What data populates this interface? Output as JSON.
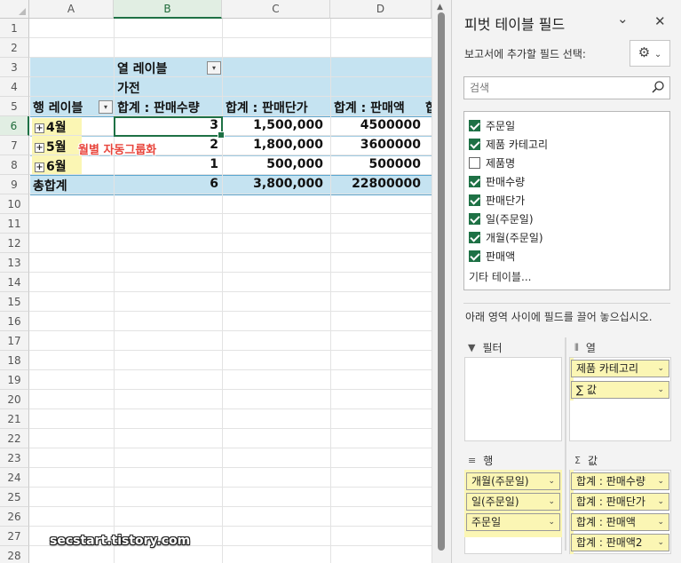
{
  "sheet": {
    "columns": [
      "A",
      "B",
      "C",
      "D"
    ],
    "rows": [
      "1",
      "2",
      "3",
      "4",
      "5",
      "6",
      "7",
      "8",
      "9",
      "10",
      "11",
      "12",
      "13",
      "14",
      "15",
      "16",
      "17",
      "18",
      "19",
      "20",
      "21",
      "22",
      "23",
      "24",
      "25",
      "26",
      "27",
      "28"
    ],
    "pivot": {
      "col_label_header": "열 레이블",
      "col_category": "가전",
      "row_label_header": "행 레이블",
      "value_headers": [
        "합계 : 판매수량",
        "합계 : 판매단가",
        "합계 : 판매액",
        "합"
      ],
      "rows": [
        {
          "label": "4월",
          "values": [
            "3",
            "1,500,000",
            "4500000"
          ]
        },
        {
          "label": "5월",
          "values": [
            "2",
            "1,800,000",
            "3600000"
          ]
        },
        {
          "label": "6월",
          "values": [
            "1",
            "500,000",
            "500000"
          ]
        }
      ],
      "total": {
        "label": "총합계",
        "values": [
          "6",
          "3,800,000",
          "22800000"
        ]
      },
      "expand_symbol": "+",
      "filter_symbol": "▾"
    },
    "annotation": "월별 자동그룹화",
    "watermark": "secstart.tistory.com"
  },
  "pane": {
    "title": "피벗 테이블 필드",
    "collapse_icon": "⌄",
    "close_icon": "✕",
    "choose_label": "보고서에 추가할 필드 선택:",
    "gear_icon": "⚙",
    "gear_dropdown": "⌄",
    "search_placeholder": "검색",
    "fields": [
      {
        "label": "주문일",
        "checked": true
      },
      {
        "label": "제품 카테고리",
        "checked": true
      },
      {
        "label": "제품명",
        "checked": false
      },
      {
        "label": "판매수량",
        "checked": true
      },
      {
        "label": "판매단가",
        "checked": true
      },
      {
        "label": "일(주문일)",
        "checked": true
      },
      {
        "label": "개월(주문일)",
        "checked": true
      },
      {
        "label": "판매액",
        "checked": true
      }
    ],
    "more_tables": "기타 테이블...",
    "drag_hint": "아래 영역 사이에 필드를 끌어 놓으십시오.",
    "areas": {
      "filter": {
        "label": "필터",
        "icon": "▼"
      },
      "columns": {
        "label": "열",
        "icon": "⦀",
        "items": [
          "제품 카테고리",
          "∑ 값"
        ]
      },
      "rows": {
        "label": "행",
        "icon": "≡",
        "items": [
          "개월(주문일)",
          "일(주문일)",
          "주문일"
        ]
      },
      "values": {
        "label": "값",
        "icon": "Σ",
        "items": [
          "합계 : 판매수량",
          "합계 : 판매단가",
          "합계 : 판매액",
          "합계 : 판매액2"
        ]
      }
    },
    "pill_dropdown": "⌄"
  }
}
